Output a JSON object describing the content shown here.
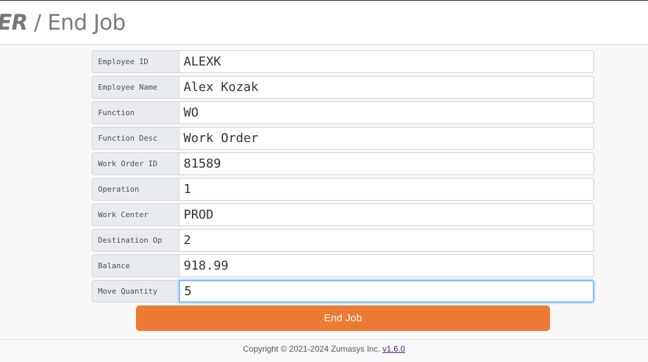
{
  "header": {
    "brand_fragment": "ER",
    "separator": " / ",
    "page_title": "End Job"
  },
  "fields": [
    {
      "label": "Employee ID",
      "value": "ALEXK"
    },
    {
      "label": "Employee Name",
      "value": "Alex Kozak"
    },
    {
      "label": "Function",
      "value": "WO"
    },
    {
      "label": "Function Desc",
      "value": "Work Order"
    },
    {
      "label": "Work Order ID",
      "value": "81589"
    },
    {
      "label": "Operation",
      "value": "1"
    },
    {
      "label": "Work Center",
      "value": "PROD"
    },
    {
      "label": "Destination Op",
      "value": "2"
    },
    {
      "label": "Balance",
      "value": "918.99"
    },
    {
      "label": "Move Quantity",
      "value": "5"
    }
  ],
  "actions": {
    "end_job_label": "End Job",
    "accent_color": "#ec7a33"
  },
  "footer": {
    "copyright": "Copyright © 2021-2024 Zumasys Inc. ",
    "version_link": "v1.6.0"
  }
}
